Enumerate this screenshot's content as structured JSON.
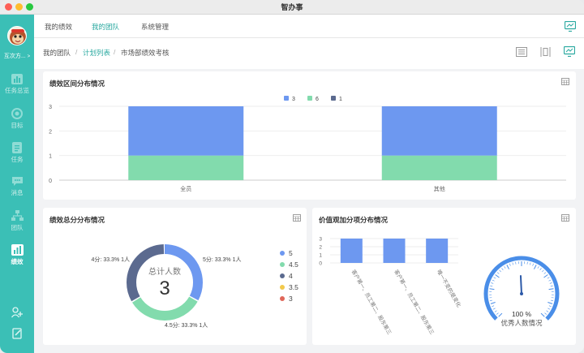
{
  "window": {
    "title": "智办事"
  },
  "sidebar": {
    "user": "互次方...",
    "items": [
      {
        "label": "任务总览"
      },
      {
        "label": "目标"
      },
      {
        "label": "任务"
      },
      {
        "label": "消息"
      },
      {
        "label": "团队"
      },
      {
        "label": "绩效"
      }
    ]
  },
  "topnav": {
    "tabs": [
      "我的绩效",
      "我的团队",
      "系统管理"
    ]
  },
  "breadcrumb": {
    "items": [
      "我的团队",
      "计划列表",
      "市场部绩效考核"
    ]
  },
  "colors": {
    "accent": "#2aa9a0",
    "blue": "#6d98f0",
    "green": "#82dbad",
    "navy": "#5b6a8f",
    "yellow": "#f2c94c",
    "red": "#e0675a",
    "teal_sidebar": "#3bbfb6"
  },
  "panels": {
    "p1": {
      "title": "绩效区间分布情况"
    },
    "p2": {
      "title": "绩效总分分布情况",
      "center_label": "总计人数",
      "center_value": "3"
    },
    "p3": {
      "title": "价值观加分项分布情况",
      "gauge_value": "100 %",
      "gauge_label": "优秀人数情况"
    }
  },
  "chart_data": [
    {
      "type": "bar",
      "title": "绩效区间分布情况",
      "stacked": true,
      "categories": [
        "全员",
        "其他"
      ],
      "series": [
        {
          "name": "3",
          "values": [
            2,
            2
          ],
          "color": "#6d98f0"
        },
        {
          "name": "6",
          "values": [
            1,
            1
          ],
          "color": "#82dbad"
        },
        {
          "name": "1",
          "values": [
            0,
            0
          ],
          "color": "#5b6a8f"
        }
      ],
      "ylim": [
        0,
        3
      ],
      "yticks": [
        0,
        1,
        2,
        3
      ],
      "legend": "top-center",
      "grid": true
    },
    {
      "type": "pie",
      "title": "绩效总分分布情况",
      "donut": true,
      "slices": [
        {
          "name": "5",
          "value": 1,
          "label": "5分:  33.3%  1人",
          "color": "#6d98f0"
        },
        {
          "name": "4.5",
          "value": 1,
          "label": "4.5分:  33.3%  1人",
          "color": "#82dbad"
        },
        {
          "name": "4",
          "value": 1,
          "label": "4分:  33.3%  1人",
          "color": "#5b6a8f"
        },
        {
          "name": "3.5",
          "value": 0,
          "color": "#f2c94c"
        },
        {
          "name": "3",
          "value": 0,
          "color": "#e0675a"
        }
      ],
      "legend": "right"
    },
    {
      "type": "bar",
      "title": "价值观加分项分布情况",
      "categories": [
        "客户第一、员工第二、股东第三",
        "客户第一、员工第二、股东第三",
        "唯一不变的是变化"
      ],
      "values": [
        3,
        3,
        3
      ],
      "ylim": [
        0,
        3
      ],
      "yticks": [
        0,
        1,
        2,
        3
      ],
      "color": "#6d98f0"
    },
    {
      "type": "gauge",
      "value": 100,
      "unit": "%",
      "label": "优秀人数情况"
    }
  ]
}
